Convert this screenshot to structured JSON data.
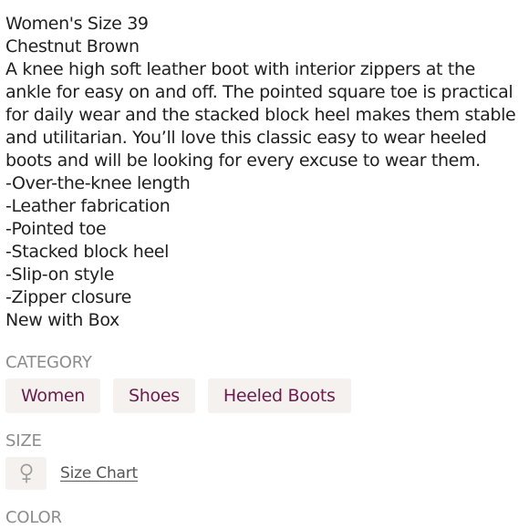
{
  "description": {
    "size_line": "Women's Size 39",
    "color_line": "Chestnut Brown",
    "paragraph_lines": [
      "A knee high soft leather boot with interior zippers at the",
      "ankle for easy on and off. The pointed square toe is practical",
      "for daily wear and the stacked block heel makes them stable",
      "and utilitarian. You’ll love this classic easy to wear heeled",
      "boots and will be looking for every excuse to wear them."
    ],
    "features": [
      "-Over-the-knee length",
      "-Leather fabrication",
      "-Pointed toe",
      "-Stacked block heel",
      "-Slip-on style",
      "-Zipper closure"
    ],
    "condition": "New with Box"
  },
  "category": {
    "label": "CATEGORY",
    "chips": [
      "Women",
      "Shoes",
      "Heeled Boots"
    ],
    "chip_text_color": "#6b1d4f",
    "chip_background": "#f4f1ef"
  },
  "size": {
    "label": "SIZE",
    "icon": "female-symbol-icon",
    "size_chart_link": "Size Chart"
  },
  "color": {
    "label": "COLOR"
  }
}
